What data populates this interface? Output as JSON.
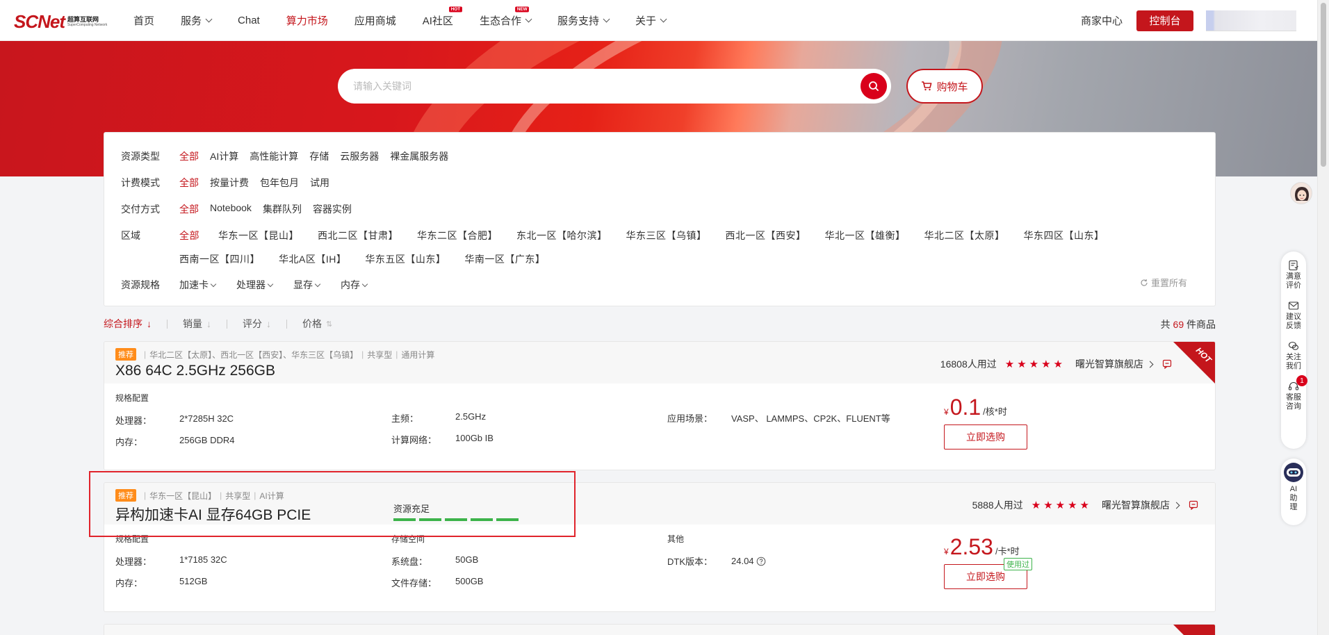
{
  "brand": {
    "logo_text": "SCNet",
    "logo_cn": "超算互联网",
    "logo_en": "SuperComputing Network"
  },
  "nav": {
    "items": [
      {
        "label": "首页",
        "dropdown": false
      },
      {
        "label": "服务",
        "dropdown": true
      },
      {
        "label": "Chat",
        "dropdown": false
      },
      {
        "label": "算力市场",
        "dropdown": false,
        "active": true
      },
      {
        "label": "应用商城",
        "dropdown": false
      },
      {
        "label": "AI社区",
        "dropdown": false,
        "badge": "HOT"
      },
      {
        "label": "生态合作",
        "dropdown": true,
        "badge": "NEW"
      },
      {
        "label": "服务支持",
        "dropdown": true
      },
      {
        "label": "关于",
        "dropdown": true
      }
    ],
    "merchant_center": "商家中心",
    "console": "控制台"
  },
  "search": {
    "placeholder": "请输入关键词",
    "cart_label": "购物车"
  },
  "filters": {
    "resource_type": {
      "label": "资源类型",
      "options": [
        "全部",
        "AI计算",
        "高性能计算",
        "存储",
        "云服务器",
        "裸金属服务器"
      ]
    },
    "billing": {
      "label": "计费模式",
      "options": [
        "全部",
        "按量计费",
        "包年包月",
        "试用"
      ]
    },
    "delivery": {
      "label": "交付方式",
      "options": [
        "全部",
        "Notebook",
        "集群队列",
        "容器实例"
      ]
    },
    "region": {
      "label": "区域",
      "options": [
        "全部",
        "华东一区【昆山】",
        "西北二区【甘肃】",
        "华东二区【合肥】",
        "东北一区【哈尔滨】",
        "华东三区【乌镇】",
        "西北一区【西安】",
        "华北一区【雄衡】",
        "华北二区【太原】",
        "华东四区【山东】",
        "西南一区【四川】",
        "华北A区【IH】",
        "华东五区【山东】",
        "华南一区【广东】"
      ]
    },
    "spec": {
      "label": "资源规格",
      "options": [
        "加速卡",
        "处理器",
        "显存",
        "内存"
      ]
    },
    "reset": "重置所有"
  },
  "sort": {
    "items": [
      "综合排序",
      "销量",
      "评分",
      "价格"
    ],
    "total_prefix": "共",
    "total_count": "69",
    "total_suffix": "件商品"
  },
  "products": [
    {
      "tag": "推荐",
      "meta": [
        "华北二区【太原】、西北一区【西安】、华东三区【乌镇】",
        "共享型",
        "通用计算"
      ],
      "title": "X86 64C 2.5GHz 256GB",
      "users": "16808人用过",
      "rating": 5,
      "shop": "曙光智算旗舰店",
      "hot": "HOT",
      "spec_caption": "规格配置",
      "col1": [
        {
          "k": "处理器：",
          "v": "2*7285H 32C"
        },
        {
          "k": "内存：",
          "v": "256GB DDR4"
        }
      ],
      "col2": [
        {
          "k": "主频：",
          "v": "2.5GHz"
        },
        {
          "k": "计算网络：",
          "v": "100Gb IB"
        }
      ],
      "col3": [
        {
          "k": "应用场景：",
          "v": "VASP、 LAMMPS、CP2K、FLUENT等"
        }
      ],
      "price_currency": "¥",
      "price": "0.1",
      "price_unit": "/核*时",
      "buy": "立即选购"
    },
    {
      "tag": "推荐",
      "meta": [
        "华东一区【昆山】",
        "共享型",
        "AI计算"
      ],
      "title": "异构加速卡AI 显存64GB PCIE",
      "stock_label": "资源充足",
      "stock_level": 5,
      "users": "5888人用过",
      "rating": 5,
      "shop": "曙光智算旗舰店",
      "spec_caption": "规格配置",
      "storage_caption": "存储空间",
      "other_caption": "其他",
      "col1": [
        {
          "k": "处理器：",
          "v": "1*7185 32C"
        },
        {
          "k": "内存：",
          "v": "512GB"
        }
      ],
      "col2": [
        {
          "k": "系统盘：",
          "v": "50GB"
        },
        {
          "k": "文件存储：",
          "v": "500GB"
        }
      ],
      "col3": [
        {
          "k": "DTK版本：",
          "v": "24.04"
        }
      ],
      "price_currency": "¥",
      "price": "2.53",
      "price_unit": "/卡*时",
      "buy": "立即选购",
      "used_badge": "使用过"
    }
  ],
  "float_bar": {
    "items": [
      "满意评价",
      "建议反馈",
      "关注我们",
      "客服咨询"
    ],
    "notif_count": "1",
    "ai_label": "AI助理"
  }
}
